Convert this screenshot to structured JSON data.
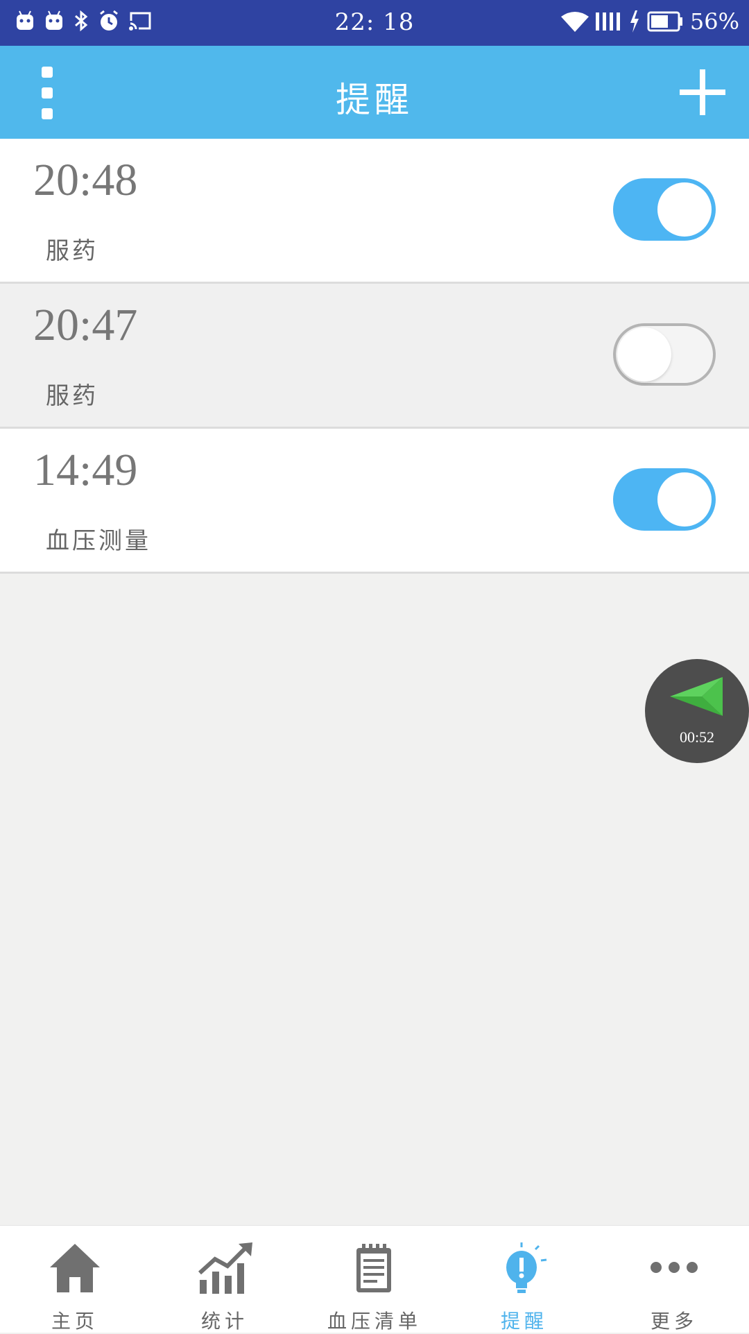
{
  "status_bar": {
    "time": "22: 18",
    "battery": "56%",
    "icons_left": [
      "android-icon",
      "android-icon",
      "bluetooth-icon",
      "alarm-icon",
      "cast-icon"
    ],
    "icons_right": [
      "wifi-icon",
      "signal-icon",
      "charging-icon",
      "battery-icon"
    ]
  },
  "header": {
    "title": "提醒",
    "menu_icon": "vertical-dots-icon",
    "add_icon": "plus-icon"
  },
  "reminders": [
    {
      "time": "20:48",
      "label": "服药",
      "enabled": true
    },
    {
      "time": "20:47",
      "label": "服药",
      "enabled": false
    },
    {
      "time": "14:49",
      "label": "血压测量",
      "enabled": true
    }
  ],
  "floating": {
    "timer": "00:52",
    "icon": "paper-plane-icon"
  },
  "tabs": [
    {
      "label": "主页",
      "icon": "home-icon",
      "active": false
    },
    {
      "label": "统计",
      "icon": "chart-icon",
      "active": false
    },
    {
      "label": "血压清单",
      "icon": "notepad-icon",
      "active": false
    },
    {
      "label": "提醒",
      "icon": "bulb-alert-icon",
      "active": true
    },
    {
      "label": "更多",
      "icon": "more-dots-icon",
      "active": false
    }
  ],
  "colors": {
    "status_bar": "#2f43a2",
    "header": "#50b8ec",
    "toggle_on": "#4db5f3",
    "tab_active": "#4fb3ec"
  }
}
